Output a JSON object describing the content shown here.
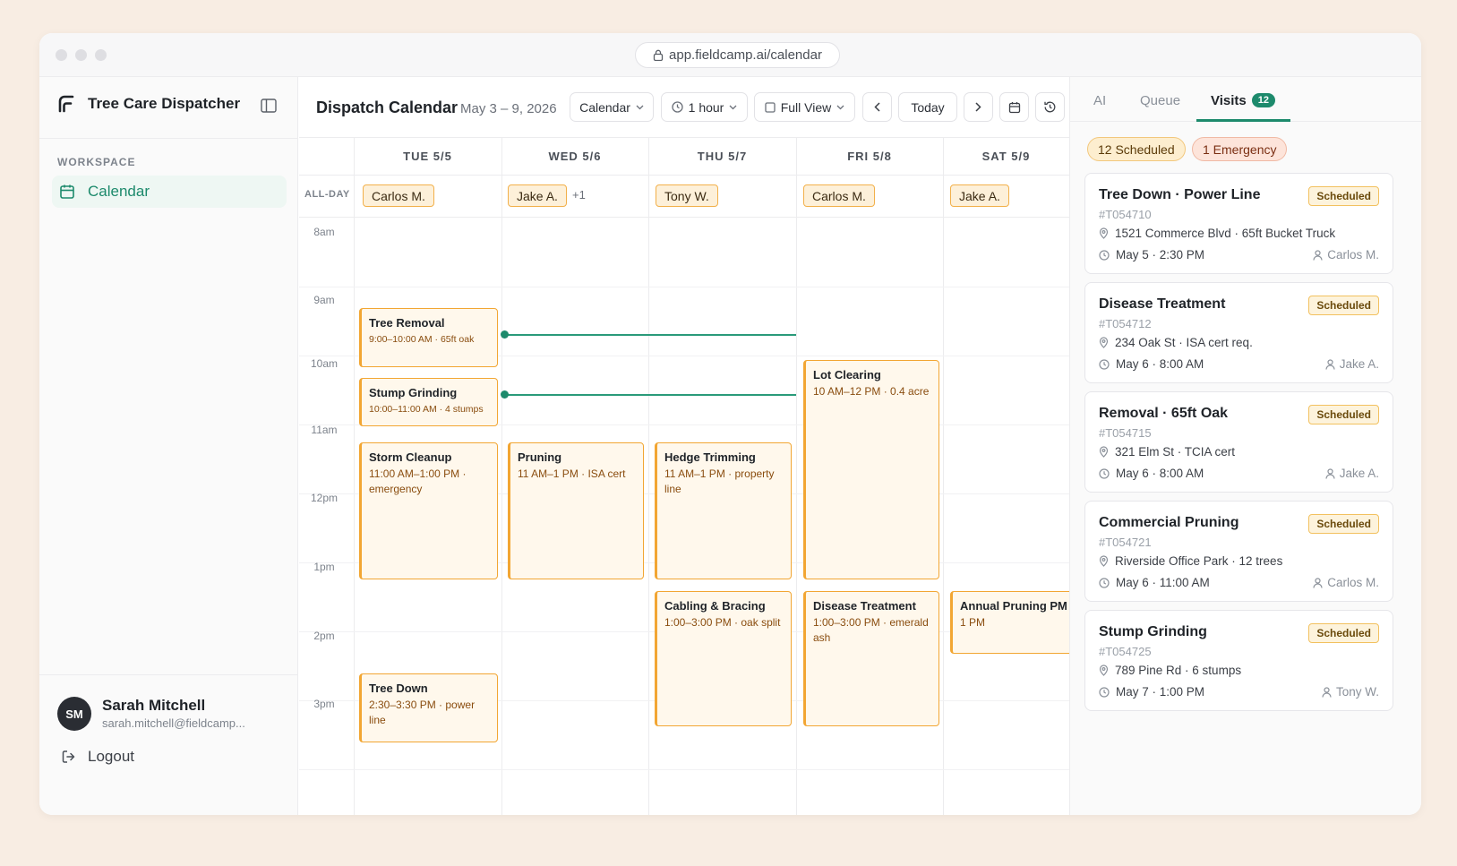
{
  "browser": {
    "url": "app.fieldcamp.ai/calendar"
  },
  "sidebar": {
    "brand": "Tree Care Dispatcher",
    "section_label": "WORKSPACE",
    "nav_item": "Calendar",
    "user": {
      "initials": "SM",
      "name": "Sarah Mitchell",
      "email": "sarah.mitchell@fieldcamp..."
    },
    "logout": "Logout"
  },
  "toolbar": {
    "title": "Dispatch Calendar",
    "date_range": "May 3 – 9, 2026",
    "view_select": "Calendar",
    "interval_select": "1 hour",
    "mode_select": "Full View",
    "today": "Today"
  },
  "calendar": {
    "allday_label": "ALL-DAY",
    "days": [
      {
        "label": "TUE 5/5",
        "allday": "Carlos M.",
        "more": ""
      },
      {
        "label": "WED 5/6",
        "allday": "Jake A.",
        "more": "+1"
      },
      {
        "label": "THU 5/7",
        "allday": "Tony W.",
        "more": ""
      },
      {
        "label": "FRI 5/8",
        "allday": "Carlos M.",
        "more": ""
      },
      {
        "label": "SAT 5/9",
        "allday": "Jake A.",
        "more": ""
      }
    ],
    "hours": [
      "8am",
      "9am",
      "10am",
      "11am",
      "12pm",
      "1pm",
      "2pm",
      "3pm"
    ],
    "events": [
      {
        "title": "Tree Removal",
        "sub": "9:00–10:00 AM · 65ft oak"
      },
      {
        "title": "Stump Grinding",
        "sub": "10:00–11:00 AM · 4 stumps"
      },
      {
        "title": "Storm Cleanup",
        "sub": "11:00 AM–1:00 PM · emergency"
      },
      {
        "title": "Tree Down",
        "sub": "2:30–3:30 PM · power line"
      },
      {
        "title": "Pruning",
        "sub": "11 AM–1 PM · ISA cert"
      },
      {
        "title": "Hedge Trimming",
        "sub": "11 AM–1 PM · property line"
      },
      {
        "title": "Cabling & Bracing",
        "sub": "1:00–3:00 PM · oak split"
      },
      {
        "title": "Lot Clearing",
        "sub": "10 AM–12 PM · 0.4 acre"
      },
      {
        "title": "Disease Treatment",
        "sub": "1:00–3:00 PM · emerald ash"
      },
      {
        "title": "Annual Pruning PM",
        "sub": "1 PM"
      }
    ]
  },
  "panel": {
    "tabs": [
      "AI",
      "Queue",
      "Visits"
    ],
    "visits_count": "12",
    "summary": {
      "scheduled": "12 Scheduled",
      "emergency": "1 Emergency"
    },
    "visits": [
      {
        "title": "Tree Down · Power Line",
        "status": "Scheduled",
        "id": "#T054710",
        "location": "1521 Commerce Blvd · 65ft Bucket Truck",
        "time": "May 5 · 2:30 PM",
        "assignee": "Carlos M."
      },
      {
        "title": "Disease Treatment",
        "status": "Scheduled",
        "id": "#T054712",
        "location": "234 Oak St · ISA cert req.",
        "time": "May 6 · 8:00 AM",
        "assignee": "Jake A."
      },
      {
        "title": "Removal · 65ft Oak",
        "status": "Scheduled",
        "id": "#T054715",
        "location": "321 Elm St · TCIA cert",
        "time": "May 6 · 8:00 AM",
        "assignee": "Jake A."
      },
      {
        "title": "Commercial Pruning",
        "status": "Scheduled",
        "id": "#T054721",
        "location": "Riverside Office Park · 12 trees",
        "time": "May 6 · 11:00 AM",
        "assignee": "Carlos M."
      },
      {
        "title": "Stump Grinding",
        "status": "Scheduled",
        "id": "#T054725",
        "location": "789 Pine Rd · 6 stumps",
        "time": "May 7 · 1:00 PM",
        "assignee": "Tony W."
      }
    ]
  },
  "colors": {
    "accent": "#1d8a6c",
    "event_border": "#f2a633",
    "event_bg": "#fff8ec"
  }
}
